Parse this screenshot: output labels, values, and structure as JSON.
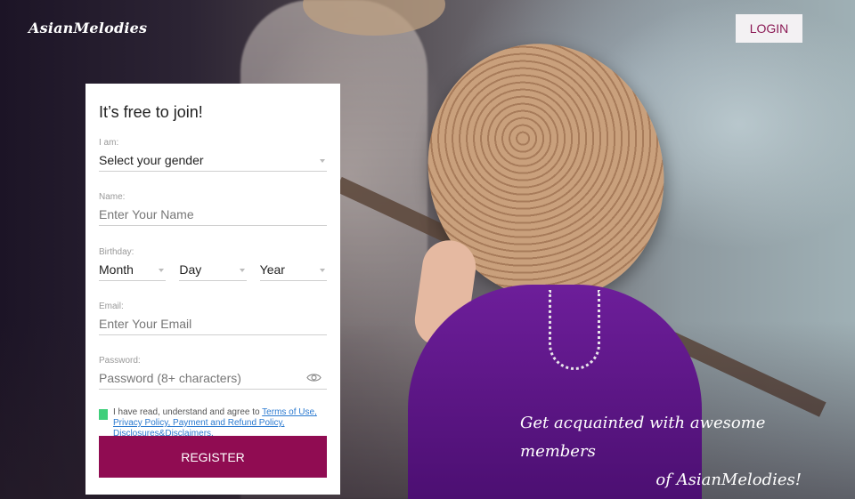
{
  "brand": {
    "logo": "AsianMelodies"
  },
  "header": {
    "login_label": "LOGIN"
  },
  "form": {
    "title": "It’s free to join!",
    "gender": {
      "label": "I am:",
      "value": "Select your gender"
    },
    "name": {
      "label": "Name:",
      "placeholder": "Enter Your Name"
    },
    "birthday": {
      "label": "Birthday:",
      "month": "Month",
      "day": "Day",
      "year": "Year"
    },
    "email": {
      "label": "Email:",
      "placeholder": "Enter Your Email"
    },
    "password": {
      "label": "Password:",
      "placeholder": "Password (8+ characters)"
    },
    "agree": {
      "text": "I have read, understand and agree to ",
      "link": "Terms of Use, Privacy Policy, Payment and Refund Policy, Disclosures&Disclaimers."
    },
    "register_label": "REGISTER"
  },
  "tagline": {
    "line1": "Get acquainted with awesome members",
    "line2": "of AsianMelodies!"
  },
  "colors": {
    "accent": "#900c52",
    "login_text": "#8b1a55",
    "checkbox": "#3fcf7b",
    "link": "#2b7ad0"
  },
  "icons": {
    "password_toggle": "eye-icon",
    "select_caret": "caret-down-icon"
  }
}
